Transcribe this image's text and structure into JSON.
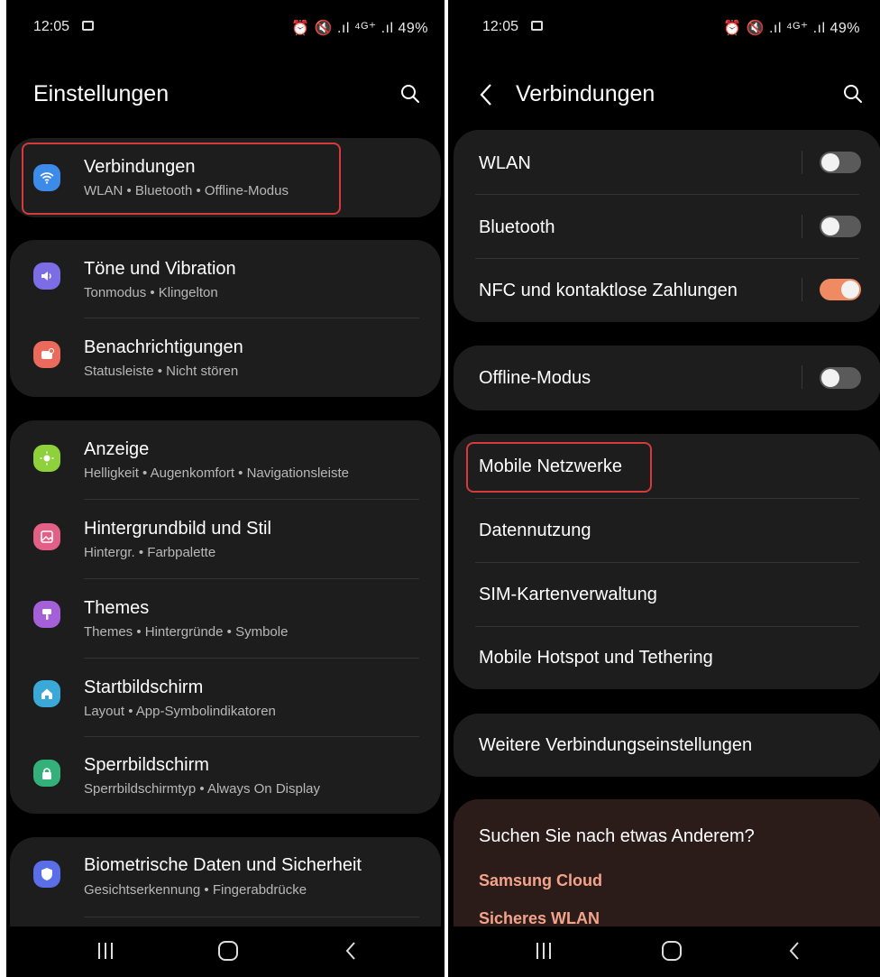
{
  "left": {
    "status": {
      "time": "12:05",
      "right": "⏰ 🔇 .ıl ⁴ᴳ⁺ .ıl 49%"
    },
    "title": "Einstellungen",
    "items": [
      {
        "title": "Verbindungen",
        "subtitle": "WLAN • Bluetooth • Offline-Modus",
        "icon": "wifi-icon",
        "color": "#3d8be8"
      },
      {
        "title": "Töne und Vibration",
        "subtitle": "Tonmodus • Klingelton",
        "icon": "volume-icon",
        "color": "#7c6ce6"
      },
      {
        "title": "Benachrichtigungen",
        "subtitle": "Statusleiste • Nicht stören",
        "icon": "notification-icon",
        "color": "#ea6a5b"
      },
      {
        "title": "Anzeige",
        "subtitle": "Helligkeit • Augenkomfort • Navigationsleiste",
        "icon": "sun-icon",
        "color": "#8fd13b"
      },
      {
        "title": "Hintergrundbild und Stil",
        "subtitle": "Hintergr. • Farbpalette",
        "icon": "image-icon",
        "color": "#e25f86"
      },
      {
        "title": "Themes",
        "subtitle": "Themes • Hintergründe • Symbole",
        "icon": "brush-icon",
        "color": "#a55fd8"
      },
      {
        "title": "Startbildschirm",
        "subtitle": "Layout • App-Symbolindikatoren",
        "icon": "home-icon",
        "color": "#3aa9d8"
      },
      {
        "title": "Sperrbildschirm",
        "subtitle": "Sperrbildschirmtyp • Always On Display",
        "icon": "lock-icon",
        "color": "#34b07a"
      },
      {
        "title": "Biometrische Daten und Sicherheit",
        "subtitle": "Gesichtserkennung • Fingerabdrücke",
        "icon": "shield-icon",
        "color": "#5a6ee8"
      }
    ]
  },
  "right": {
    "status": {
      "time": "12:05",
      "right": "⏰ 🔇 .ıl ⁴ᴳ⁺ .ıl 49%"
    },
    "title": "Verbindungen",
    "toggles": [
      {
        "label": "WLAN",
        "on": false
      },
      {
        "label": "Bluetooth",
        "on": false
      },
      {
        "label": "NFC und kontaktlose Zahlungen",
        "on": true
      },
      {
        "label": "Offline-Modus",
        "on": false
      }
    ],
    "network_items": [
      "Mobile Netzwerke",
      "Datennutzung",
      "SIM-Kartenverwaltung",
      "Mobile Hotspot und Tethering"
    ],
    "more": "Weitere Verbindungseinstellungen",
    "suggest": {
      "title": "Suchen Sie nach etwas Anderem?",
      "links": [
        "Samsung Cloud",
        "Sicheres WLAN"
      ]
    }
  },
  "nav": {
    "recent": "|||",
    "home": "○",
    "back": "<"
  },
  "colors": {
    "highlight": "#d63a3a",
    "toggle_on": "#f08a62",
    "card": "#1d1d1d"
  }
}
